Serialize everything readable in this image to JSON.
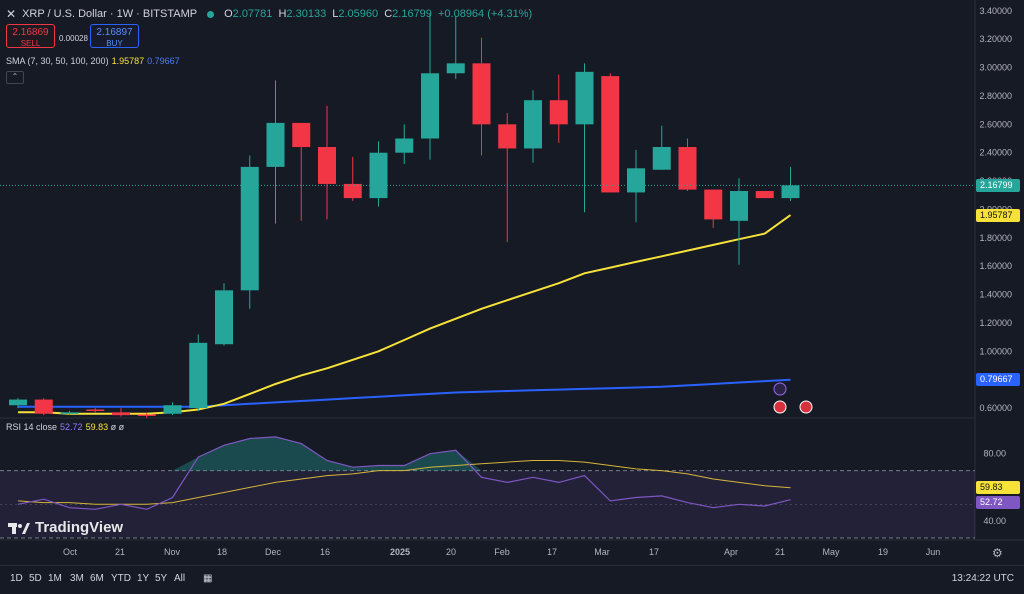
{
  "header": {
    "symbol": "XRP / U.S. Dollar · 1W · BITSTAMP",
    "o_key": "O",
    "o_val": "2.07781",
    "h_key": "H",
    "h_val": "2.30133",
    "l_key": "L",
    "l_val": "2.05960",
    "c_key": "C",
    "c_val": "2.16799",
    "change": "+0.08964 (+4.31%)"
  },
  "trade": {
    "sell_price": "2.16869",
    "sell_label": "SELL",
    "spread": "0.00028",
    "buy_price": "2.16897",
    "buy_label": "BUY"
  },
  "sma_legend": {
    "label": "SMA (7, 30, 50, 100, 200)",
    "v1": "1.95787",
    "v2": "0.79667"
  },
  "rsi_legend": {
    "label": "RSI 14 close",
    "v1": "52.72",
    "v2": "59.83",
    "v3": "ø",
    "v4": "ø"
  },
  "logo": {
    "text": "TradingView"
  },
  "timeframes": [
    "1D",
    "5D",
    "1M",
    "3M",
    "6M",
    "YTD",
    "1Y",
    "5Y",
    "All"
  ],
  "clock": "13:24:22 UTC",
  "colors": {
    "up": "#26a69a",
    "down": "#f23645",
    "sma_fast": "#f7e23a",
    "sma_slow": "#2962ff",
    "rsi": "#7e57c2",
    "rsi_ma": "#d6b53a",
    "bg": "#161a25"
  },
  "chart_data": {
    "type": "candlestick",
    "y_axis_ticks": [
      "3.40000",
      "3.20000",
      "3.00000",
      "2.80000",
      "2.60000",
      "2.40000",
      "2.20000",
      "2.00000",
      "1.80000",
      "1.60000",
      "1.40000",
      "1.20000",
      "1.00000",
      "0.80000",
      "0.60000"
    ],
    "ylim": [
      0.53,
      3.42
    ],
    "x_axis_ticks": [
      "Oct",
      "21",
      "Nov",
      "18",
      "Dec",
      "16",
      "2025",
      "20",
      "Feb",
      "17",
      "Mar",
      "17",
      "Apr",
      "21",
      "May",
      "19",
      "Jun"
    ],
    "candles": [
      {
        "o": 0.62,
        "h": 0.67,
        "l": 0.6,
        "c": 0.66
      },
      {
        "o": 0.66,
        "h": 0.67,
        "l": 0.55,
        "c": 0.56
      },
      {
        "o": 0.56,
        "h": 0.58,
        "l": 0.55,
        "c": 0.57
      },
      {
        "o": 0.59,
        "h": 0.6,
        "l": 0.57,
        "c": 0.585
      },
      {
        "o": 0.57,
        "h": 0.6,
        "l": 0.54,
        "c": 0.55
      },
      {
        "o": 0.555,
        "h": 0.57,
        "l": 0.53,
        "c": 0.55
      },
      {
        "o": 0.56,
        "h": 0.64,
        "l": 0.55,
        "c": 0.62
      },
      {
        "o": 0.6,
        "h": 1.12,
        "l": 0.58,
        "c": 1.06
      },
      {
        "o": 1.05,
        "h": 1.48,
        "l": 1.04,
        "c": 1.43
      },
      {
        "o": 1.43,
        "h": 2.38,
        "l": 1.3,
        "c": 2.3
      },
      {
        "o": 2.3,
        "h": 2.91,
        "l": 1.9,
        "c": 2.61
      },
      {
        "o": 2.61,
        "h": 2.6,
        "l": 1.92,
        "c": 2.44
      },
      {
        "o": 2.44,
        "h": 2.73,
        "l": 1.93,
        "c": 2.18
      },
      {
        "o": 2.18,
        "h": 2.37,
        "l": 2.06,
        "c": 2.08
      },
      {
        "o": 2.08,
        "h": 2.48,
        "l": 2.02,
        "c": 2.4
      },
      {
        "o": 2.4,
        "h": 2.6,
        "l": 2.32,
        "c": 2.5
      },
      {
        "o": 2.5,
        "h": 3.38,
        "l": 2.35,
        "c": 2.96
      },
      {
        "o": 2.96,
        "h": 3.36,
        "l": 2.92,
        "c": 3.03
      },
      {
        "o": 3.03,
        "h": 3.21,
        "l": 2.38,
        "c": 2.6
      },
      {
        "o": 2.6,
        "h": 2.68,
        "l": 1.77,
        "c": 2.43
      },
      {
        "o": 2.43,
        "h": 2.84,
        "l": 2.33,
        "c": 2.77
      },
      {
        "o": 2.77,
        "h": 2.95,
        "l": 2.47,
        "c": 2.6
      },
      {
        "o": 2.6,
        "h": 3.03,
        "l": 1.98,
        "c": 2.97
      },
      {
        "o": 2.94,
        "h": 2.96,
        "l": 2.12,
        "c": 2.12
      },
      {
        "o": 2.12,
        "h": 2.42,
        "l": 1.91,
        "c": 2.29
      },
      {
        "o": 2.28,
        "h": 2.59,
        "l": 2.28,
        "c": 2.44
      },
      {
        "o": 2.44,
        "h": 2.5,
        "l": 2.13,
        "c": 2.14
      },
      {
        "o": 2.14,
        "h": 2.14,
        "l": 1.87,
        "c": 1.93
      },
      {
        "o": 1.92,
        "h": 2.22,
        "l": 1.61,
        "c": 2.13
      },
      {
        "o": 2.13,
        "h": 2.13,
        "l": 2.08,
        "c": 2.08
      },
      {
        "o": 2.08,
        "h": 2.3,
        "l": 2.06,
        "c": 2.17
      }
    ],
    "sma_fast": [
      0.57,
      0.57,
      0.56,
      0.56,
      0.56,
      0.56,
      0.57,
      0.59,
      0.63,
      0.7,
      0.77,
      0.83,
      0.88,
      0.94,
      1.0,
      1.08,
      1.16,
      1.23,
      1.3,
      1.36,
      1.42,
      1.48,
      1.55,
      1.59,
      1.63,
      1.67,
      1.71,
      1.75,
      1.79,
      1.83,
      1.96
    ],
    "sma_slow": [
      0.61,
      0.61,
      0.61,
      0.61,
      0.61,
      0.61,
      0.61,
      0.61,
      0.62,
      0.63,
      0.64,
      0.65,
      0.66,
      0.67,
      0.68,
      0.69,
      0.7,
      0.71,
      0.715,
      0.72,
      0.725,
      0.73,
      0.735,
      0.74,
      0.745,
      0.75,
      0.76,
      0.77,
      0.78,
      0.79,
      0.8
    ],
    "last_price_label": "2.16799",
    "sma_fast_label": "1.95787",
    "sma_slow_label": "0.79667",
    "rsi": {
      "y_ticks": [
        "80.00",
        "40.00"
      ],
      "ylim": [
        30,
        100
      ],
      "levels": [
        70,
        30
      ],
      "rsi_values": [
        50,
        53,
        48,
        47,
        50,
        47,
        54,
        78,
        85,
        89,
        90,
        86,
        76,
        72,
        73,
        73,
        80,
        82,
        66,
        63,
        66,
        63,
        67,
        52,
        54,
        55,
        51,
        48,
        50,
        49,
        52.72
      ],
      "rsi_ma_values": [
        52,
        51,
        51,
        50,
        50,
        50,
        51,
        54,
        57,
        60,
        63,
        65,
        67,
        68,
        70,
        70,
        72,
        73,
        74,
        75,
        76,
        76,
        75,
        73,
        71,
        70,
        68,
        65,
        63,
        61,
        59.83
      ],
      "rsi_label": "52.72",
      "rsi_ma_label": "59.83"
    }
  }
}
